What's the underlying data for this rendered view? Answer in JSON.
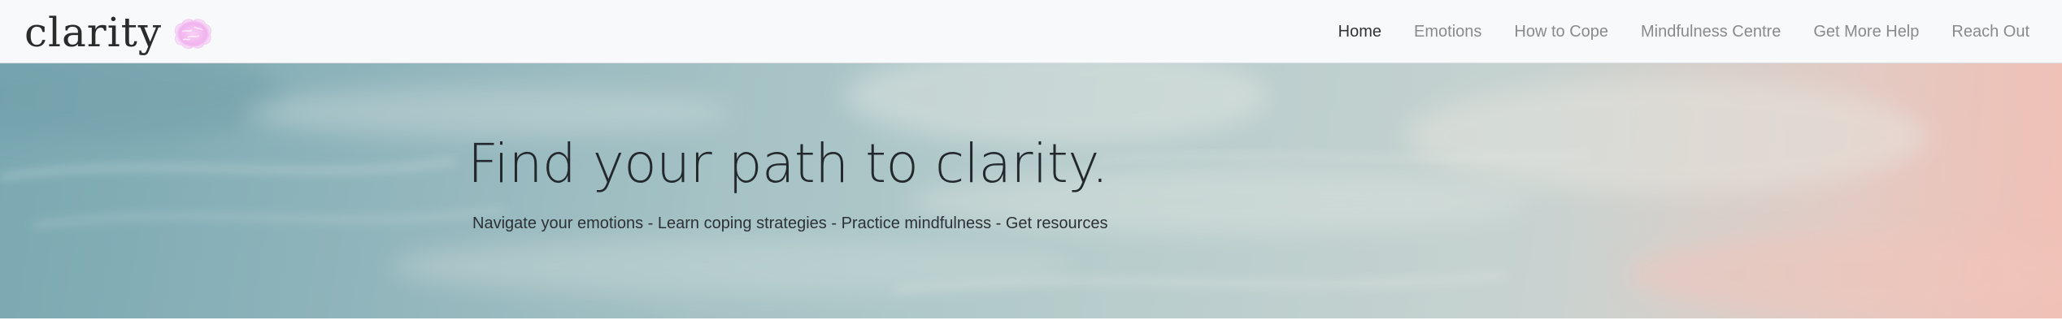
{
  "brand": {
    "name": "clarity",
    "logo_icon": "brain-icon",
    "logo_color": "#f3b8f0"
  },
  "nav": {
    "items": [
      {
        "label": "Home",
        "active": true
      },
      {
        "label": "Emotions",
        "active": false
      },
      {
        "label": "How to Cope",
        "active": false
      },
      {
        "label": "Mindfulness Centre",
        "active": false
      },
      {
        "label": "Get More Help",
        "active": false
      },
      {
        "label": "Reach Out",
        "active": false
      }
    ]
  },
  "hero": {
    "title": "Find your path to clarity.",
    "subtitle": "Navigate your emotions - Learn coping strategies - Practice mindfulness - Get resources"
  },
  "colors": {
    "nav_active": "#333333",
    "nav_inactive": "#8a8a8a",
    "navbar_bg": "#f8f9fb"
  }
}
